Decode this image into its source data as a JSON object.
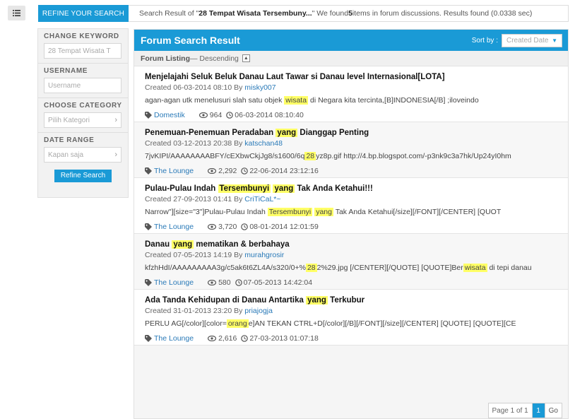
{
  "colors": {
    "accent": "#1a9ad6",
    "highlight": "#ffff66",
    "link": "#2a7ab8"
  },
  "header": {
    "refine_tab": "REFINE YOUR SEARCH",
    "summary_prefix": "Search Result of \"",
    "summary_query": "28 Tempat Wisata Tersembuny...",
    "summary_mid": "\" We found ",
    "summary_count": "5",
    "summary_suffix": " items in forum discussions. Results found (0.0338 sec)"
  },
  "sidebar": {
    "keyword_label": "CHANGE KEYWORD",
    "keyword_value": "28 Tempat Wisata T",
    "username_label": "USERNAME",
    "username_placeholder": "Username",
    "category_label": "CHOOSE CATEGORY",
    "category_placeholder": "Pilih Kategori",
    "date_label": "DATE RANGE",
    "date_placeholder": "Kapan saja",
    "refine_button": "Refine Search"
  },
  "main": {
    "title": "Forum Search Result",
    "sort_label": "Sort by :",
    "sort_value": "Created Date",
    "listing_label": "Forum Listing",
    "listing_order": " — Descending"
  },
  "results": [
    {
      "title_parts": [
        {
          "t": "Menjelajahi Seluk Beluk Danau Laut Tawar si Danau level Internasional[LOTA]",
          "h": false
        }
      ],
      "created": "Created 06-03-2014 08:10 By ",
      "author": "misky007",
      "snippet_parts": [
        {
          "t": "agan-agan utk menelusuri slah satu objek ",
          "h": false
        },
        {
          "t": "wisata",
          "h": true
        },
        {
          "t": " di Negara kita tercinta,[B]INDONESIA[/B] ;iloveindo",
          "h": false
        }
      ],
      "category": "Domestik",
      "views": "964",
      "date": "06-03-2014 08:10:40"
    },
    {
      "title_parts": [
        {
          "t": "Penemuan-Penemuan Peradaban ",
          "h": false
        },
        {
          "t": "yang",
          "h": true
        },
        {
          "t": " Dianggap Penting",
          "h": false
        }
      ],
      "created": "Created 03-12-2013 20:38 By ",
      "author": "katschan48",
      "snippet_parts": [
        {
          "t": "7jvKIPI/AAAAAAAABFY/cEXbwCkjJg8/s1600/6q",
          "h": false
        },
        {
          "t": "28",
          "h": true
        },
        {
          "t": "yz8p.gif http://4.bp.blogspot.com/-p3nk9c3a7hk/Up24yI0hm",
          "h": false
        }
      ],
      "category": "The Lounge",
      "views": "2,292",
      "date": "22-06-2014 23:12:16"
    },
    {
      "title_parts": [
        {
          "t": "Pulau-Pulau Indah ",
          "h": false
        },
        {
          "t": "Tersembunyi",
          "h": true
        },
        {
          "t": " ",
          "h": false
        },
        {
          "t": "yang",
          "h": true
        },
        {
          "t": " Tak Anda Ketahui!!!",
          "h": false
        }
      ],
      "created": "Created 27-09-2013 01:41 By ",
      "author": "CriTiCaL*~",
      "snippet_parts": [
        {
          "t": "Narrow\"][size=\"3\"]Pulau-Pulau Indah ",
          "h": false
        },
        {
          "t": "Tersembunyi",
          "h": true
        },
        {
          "t": " ",
          "h": false
        },
        {
          "t": "yang",
          "h": true
        },
        {
          "t": " Tak Anda Ketahui[/size][/FONT][/CENTER] [QUOT",
          "h": false
        }
      ],
      "category": "The Lounge",
      "views": "3,720",
      "date": "08-01-2014 12:01:59"
    },
    {
      "title_parts": [
        {
          "t": "Danau ",
          "h": false
        },
        {
          "t": "yang",
          "h": true
        },
        {
          "t": " mematikan & berbahaya",
          "h": false
        }
      ],
      "created": "Created 07-05-2013 14:19 By ",
      "author": "murahgrosir",
      "snippet_parts": [
        {
          "t": "kfzhHdI/AAAAAAAAA3g/c5ak6t6ZL4A/s320/0+%",
          "h": false
        },
        {
          "t": "28",
          "h": true
        },
        {
          "t": "2%29.jpg [/CENTER][/QUOTE] [QUOTE]Ber",
          "h": false
        },
        {
          "t": "wisata",
          "h": true
        },
        {
          "t": " di tepi danau",
          "h": false
        }
      ],
      "category": "The Lounge",
      "views": "580",
      "date": "07-05-2013 14:42:04"
    },
    {
      "title_parts": [
        {
          "t": "Ada Tanda Kehidupan di Danau Antartika ",
          "h": false
        },
        {
          "t": "yang",
          "h": true
        },
        {
          "t": " Terkubur",
          "h": false
        }
      ],
      "created": "Created 31-01-2013 23:20 By ",
      "author": "priajogja",
      "snippet_parts": [
        {
          "t": "PERLU AG[/color][color=",
          "h": false
        },
        {
          "t": "orang",
          "h": true
        },
        {
          "t": "e]AN TEKAN CTRL+D[/color][/B][/FONT][/size][/CENTER] [QUOTE] [QUOTE][CE",
          "h": false
        }
      ],
      "category": "The Lounge",
      "views": "2,616",
      "date": "27-03-2013 01:07:18"
    }
  ],
  "pager": {
    "page_info": "Page 1 of 1",
    "current": "1",
    "go": "Go"
  }
}
